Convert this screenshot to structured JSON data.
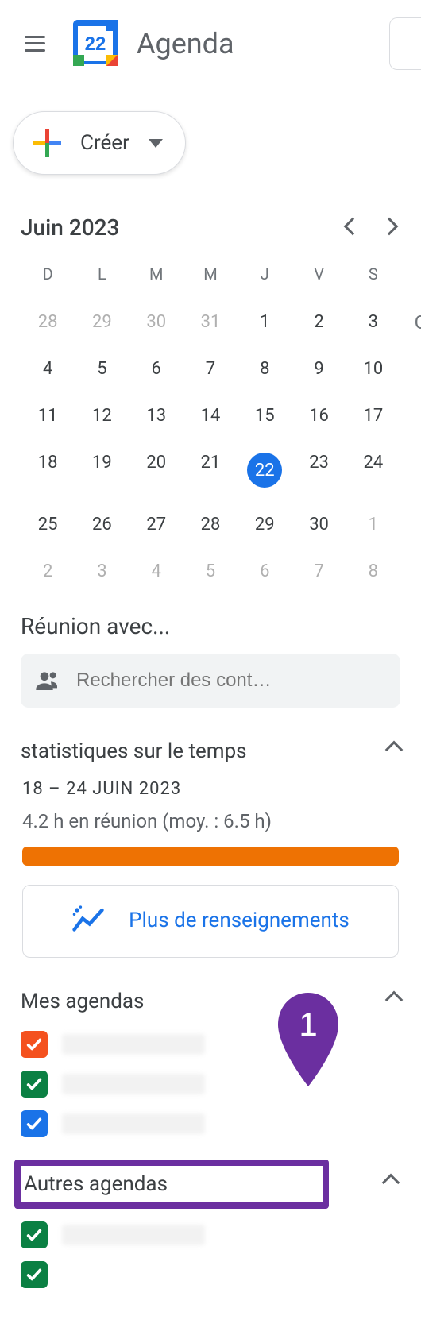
{
  "header": {
    "app_title": "Agenda",
    "logo_day": "22"
  },
  "create": {
    "label": "Créer"
  },
  "mini_calendar": {
    "title": "Juin 2023",
    "dow": [
      "D",
      "L",
      "M",
      "M",
      "J",
      "V",
      "S"
    ],
    "days": [
      {
        "n": "28",
        "m": true
      },
      {
        "n": "29",
        "m": true
      },
      {
        "n": "30",
        "m": true
      },
      {
        "n": "31",
        "m": true
      },
      {
        "n": "1"
      },
      {
        "n": "2"
      },
      {
        "n": "3"
      },
      {
        "n": "4"
      },
      {
        "n": "5"
      },
      {
        "n": "6"
      },
      {
        "n": "7"
      },
      {
        "n": "8"
      },
      {
        "n": "9"
      },
      {
        "n": "10"
      },
      {
        "n": "11"
      },
      {
        "n": "12"
      },
      {
        "n": "13"
      },
      {
        "n": "14"
      },
      {
        "n": "15"
      },
      {
        "n": "16"
      },
      {
        "n": "17"
      },
      {
        "n": "18"
      },
      {
        "n": "19"
      },
      {
        "n": "20"
      },
      {
        "n": "21"
      },
      {
        "n": "22",
        "today": true
      },
      {
        "n": "23"
      },
      {
        "n": "24"
      },
      {
        "n": "25"
      },
      {
        "n": "26"
      },
      {
        "n": "27"
      },
      {
        "n": "28"
      },
      {
        "n": "29"
      },
      {
        "n": "30"
      },
      {
        "n": "1",
        "m": true
      },
      {
        "n": "2",
        "m": true
      },
      {
        "n": "3",
        "m": true
      },
      {
        "n": "4",
        "m": true
      },
      {
        "n": "5",
        "m": true
      },
      {
        "n": "6",
        "m": true
      },
      {
        "n": "7",
        "m": true
      },
      {
        "n": "8",
        "m": true
      }
    ]
  },
  "meet_with": {
    "title": "Réunion avec...",
    "placeholder": "Rechercher des cont…"
  },
  "time_insights": {
    "title": "statistiques sur le temps",
    "range": "18 – 24 JUIN 2023",
    "avg": "4.2 h en réunion (moy. : 6.5 h)",
    "more": "Plus de renseignements"
  },
  "my_calendars": {
    "title": "Mes agendas",
    "items": [
      {
        "color": "#f4511e"
      },
      {
        "color": "#0b8043"
      },
      {
        "color": "#1a73e8"
      }
    ]
  },
  "other_calendars": {
    "title": "Autres agendas",
    "items": [
      {
        "color": "#0b8043",
        "name": ""
      },
      {
        "color": "#0b8043",
        "name": ""
      }
    ]
  },
  "annotations": {
    "marker1": "1"
  },
  "overflow_letter": "G"
}
